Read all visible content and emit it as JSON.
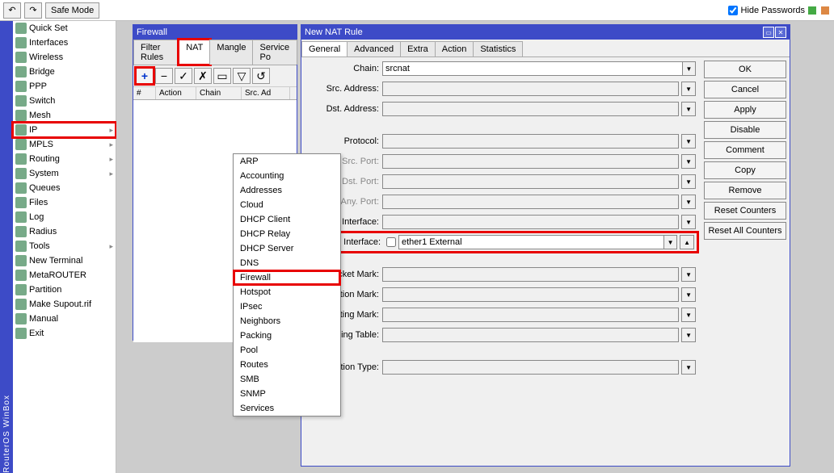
{
  "toolbar": {
    "safe_mode": "Safe Mode",
    "hide_passwords": "Hide Passwords"
  },
  "vertical_label": "RouterOS WinBox",
  "sidebar": {
    "items": [
      {
        "label": "Quick Set",
        "arrow": false
      },
      {
        "label": "Interfaces",
        "arrow": false
      },
      {
        "label": "Wireless",
        "arrow": false
      },
      {
        "label": "Bridge",
        "arrow": false
      },
      {
        "label": "PPP",
        "arrow": false
      },
      {
        "label": "Switch",
        "arrow": false
      },
      {
        "label": "Mesh",
        "arrow": false
      },
      {
        "label": "IP",
        "arrow": true,
        "hl": true
      },
      {
        "label": "MPLS",
        "arrow": true
      },
      {
        "label": "Routing",
        "arrow": true
      },
      {
        "label": "System",
        "arrow": true
      },
      {
        "label": "Queues",
        "arrow": false
      },
      {
        "label": "Files",
        "arrow": false
      },
      {
        "label": "Log",
        "arrow": false
      },
      {
        "label": "Radius",
        "arrow": false
      },
      {
        "label": "Tools",
        "arrow": true
      },
      {
        "label": "New Terminal",
        "arrow": false
      },
      {
        "label": "MetaROUTER",
        "arrow": false
      },
      {
        "label": "Partition",
        "arrow": false
      },
      {
        "label": "Make Supout.rif",
        "arrow": false
      },
      {
        "label": "Manual",
        "arrow": false
      },
      {
        "label": "Exit",
        "arrow": false
      }
    ]
  },
  "submenu": {
    "items": [
      "ARP",
      "Accounting",
      "Addresses",
      "Cloud",
      "DHCP Client",
      "DHCP Relay",
      "DHCP Server",
      "DNS",
      "Firewall",
      "Hotspot",
      "IPsec",
      "Neighbors",
      "Packing",
      "Pool",
      "Routes",
      "SMB",
      "SNMP",
      "Services"
    ],
    "hl_index": 8
  },
  "firewall": {
    "title": "Firewall",
    "tabs": [
      "Filter Rules",
      "NAT",
      "Mangle",
      "Service Po"
    ],
    "active_tab": 1,
    "cols": [
      "#",
      "Action",
      "Chain",
      "Src. Ad"
    ]
  },
  "nat": {
    "title": "New NAT Rule",
    "tabs": [
      "General",
      "Advanced",
      "Extra",
      "Action",
      "Statistics"
    ],
    "active_tab": 0,
    "buttons": [
      "OK",
      "Cancel",
      "Apply",
      "Disable",
      "Comment",
      "Copy",
      "Remove",
      "Reset Counters",
      "Reset All Counters"
    ],
    "fields": {
      "chain_label": "Chain:",
      "chain_value": "srcnat",
      "src_addr": "Src. Address:",
      "dst_addr": "Dst. Address:",
      "protocol": "Protocol:",
      "src_port": "Src. Port:",
      "dst_port": "Dst. Port:",
      "any_port": "Any. Port:",
      "in_iface": "In. Interface:",
      "out_iface": "Out. Interface:",
      "out_iface_value": "ether1 External",
      "packet_mark": "Packet Mark:",
      "conn_mark": "Connection Mark:",
      "routing_mark": "Routing Mark:",
      "routing_table": "Routing Table:",
      "conn_type": "Connection Type:"
    }
  }
}
